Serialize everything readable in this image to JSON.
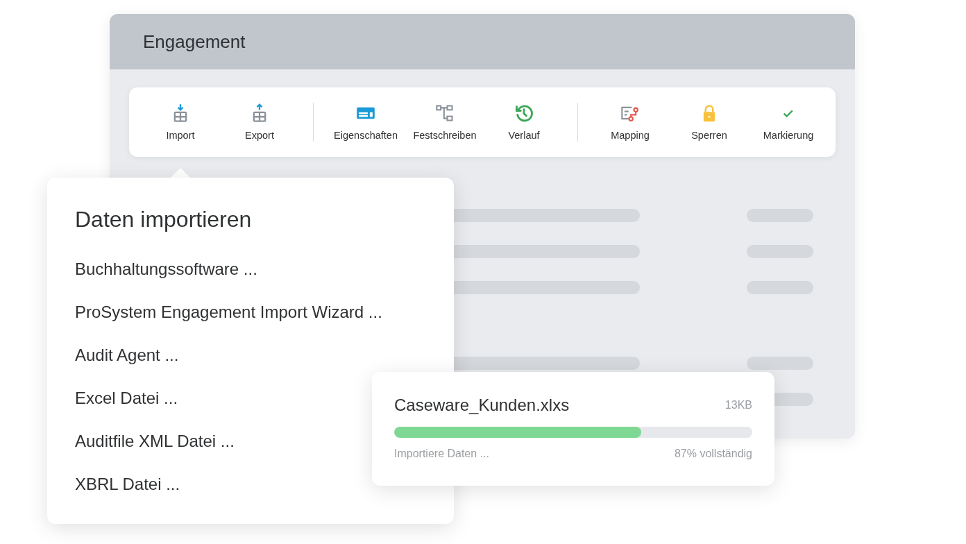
{
  "window": {
    "title": "Engagement"
  },
  "toolbar": {
    "groups": [
      {
        "items": [
          {
            "label": "Import"
          },
          {
            "label": "Export"
          }
        ]
      },
      {
        "items": [
          {
            "label": "Eigenschaften"
          },
          {
            "label": "Festschreiben"
          },
          {
            "label": "Verlauf"
          }
        ]
      },
      {
        "items": [
          {
            "label": "Mapping"
          },
          {
            "label": "Sperren"
          },
          {
            "label": "Markierung"
          }
        ]
      }
    ]
  },
  "import_menu": {
    "title": "Daten importieren",
    "items": [
      "Buchhaltungssoftware ...",
      "ProSystem Engagement Import Wizard ...",
      "Audit Agent ...",
      "Excel Datei ...",
      "Auditfile XML Datei ...",
      "XBRL Datei ..."
    ]
  },
  "upload": {
    "file_name": "Caseware_Kunden.xlxs",
    "size": "13KB",
    "level": 0.69,
    "status": "Importiere Daten ...",
    "progress_text": "87% vollständig"
  }
}
